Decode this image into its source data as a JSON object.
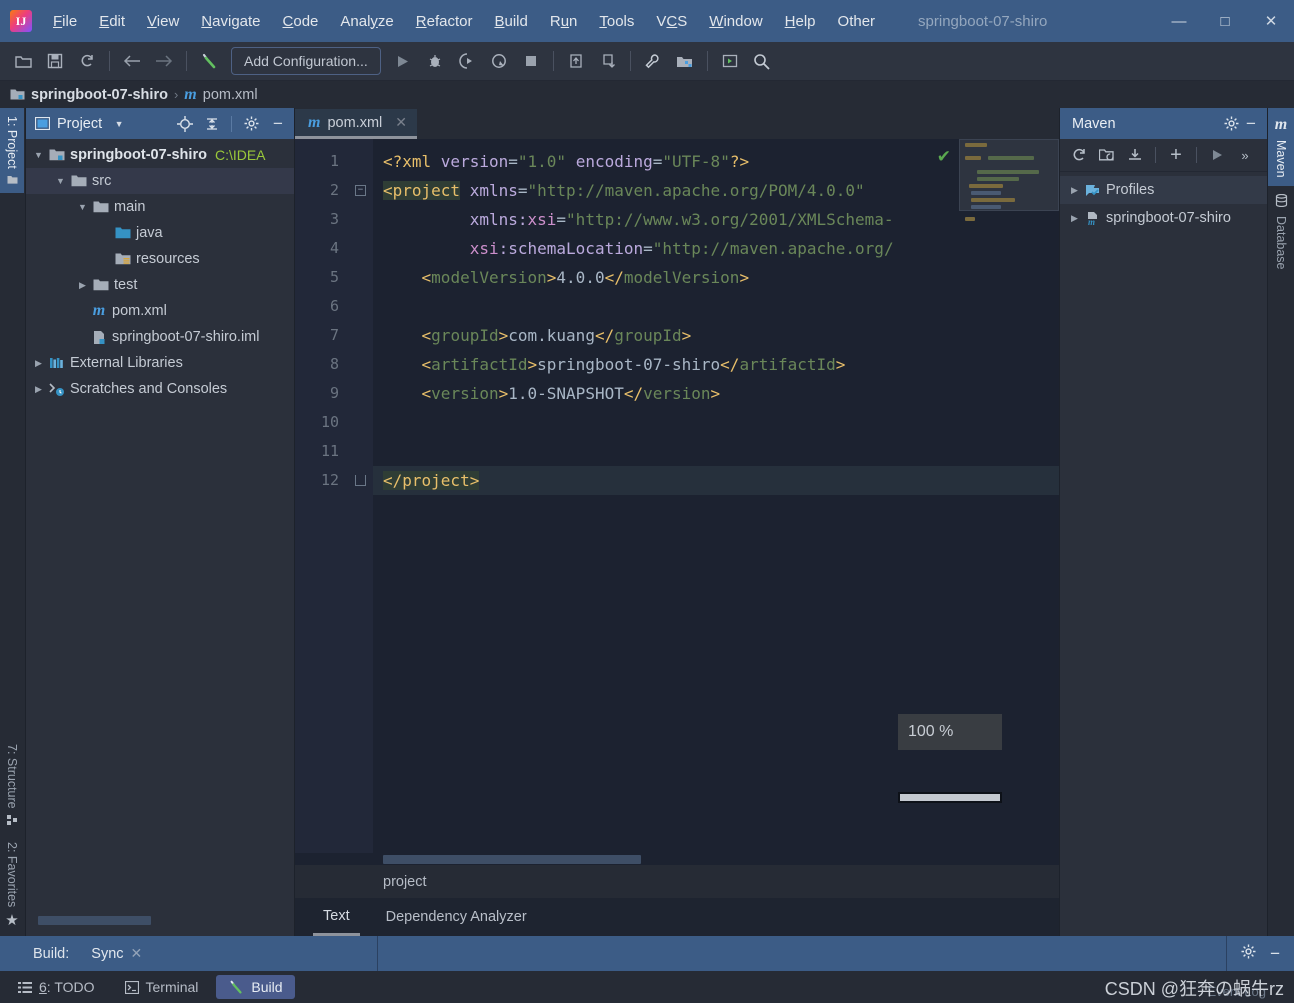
{
  "window": {
    "title": "springboot-07-shiro",
    "minimize": "—",
    "maximize": "□",
    "close": "✕"
  },
  "menu": [
    {
      "label": "File"
    },
    {
      "label": "Edit"
    },
    {
      "label": "View"
    },
    {
      "label": "Navigate"
    },
    {
      "label": "Code"
    },
    {
      "label": "Analyze"
    },
    {
      "label": "Refactor"
    },
    {
      "label": "Build"
    },
    {
      "label": "Run"
    },
    {
      "label": "Tools"
    },
    {
      "label": "VCS"
    },
    {
      "label": "Window"
    },
    {
      "label": "Help"
    },
    {
      "label": "Other"
    }
  ],
  "toolbar": {
    "run_config": "Add Configuration...",
    "icons": [
      "open-folder-icon",
      "save-icon",
      "sync-refresh-icon",
      "back-arrow-icon",
      "forward-arrow-icon",
      "build-hammer-icon",
      "run-icon",
      "debug-icon",
      "run-coverage-icon",
      "profile-icon",
      "stop-icon",
      "update-project-icon",
      "commit-icon",
      "settings-wrench-icon",
      "project-structure-icon",
      "run-anything-icon",
      "search-everywhere-icon"
    ]
  },
  "breadcrumb": {
    "project": "springboot-07-shiro",
    "separator": "›",
    "file": "pom.xml",
    "file_icon": "maven-m-icon"
  },
  "left_strip": {
    "top": [
      {
        "label": "1: Project",
        "icon": "project-folder-icon",
        "selected": true
      }
    ],
    "bottom": [
      {
        "label": "7: Structure",
        "icon": "structure-icon",
        "selected": false
      },
      {
        "label": "2: Favorites",
        "icon": "star-icon",
        "selected": false
      }
    ]
  },
  "right_strip": [
    {
      "label": "Maven",
      "icon": "maven-m-icon",
      "selected": true
    },
    {
      "label": "Database",
      "icon": "database-icon",
      "selected": false
    }
  ],
  "project_panel": {
    "title": "Project",
    "dropdown_icon": "chevron-down-icon",
    "actions": [
      "locate-target-icon",
      "collapse-all-icon",
      "gear-icon",
      "hide-icon"
    ],
    "tree": [
      {
        "depth": 0,
        "arrow": "▼",
        "icon": "module-folder-icon",
        "label": "springboot-07-shiro",
        "bold": true,
        "path": "C:\\IDEA",
        "selected": false
      },
      {
        "depth": 1,
        "arrow": "▼",
        "icon": "folder-icon",
        "label": "src",
        "bold": false,
        "path": "",
        "selected": true
      },
      {
        "depth": 2,
        "arrow": "▼",
        "icon": "folder-icon",
        "label": "main",
        "bold": false,
        "path": "",
        "selected": false
      },
      {
        "depth": 3,
        "arrow": "",
        "icon": "source-folder-icon",
        "label": "java",
        "bold": false,
        "path": "",
        "selected": false
      },
      {
        "depth": 3,
        "arrow": "",
        "icon": "resources-folder-icon",
        "label": "resources",
        "bold": false,
        "path": "",
        "selected": false
      },
      {
        "depth": 2,
        "arrow": "▶",
        "icon": "folder-icon",
        "label": "test",
        "bold": false,
        "path": "",
        "selected": false
      },
      {
        "depth": 2,
        "arrow": "",
        "icon": "maven-m-icon",
        "label": "pom.xml",
        "bold": false,
        "path": "",
        "selected": false
      },
      {
        "depth": 2,
        "arrow": "",
        "icon": "iml-file-icon",
        "label": "springboot-07-shiro.iml",
        "bold": false,
        "path": "",
        "selected": false
      },
      {
        "depth": 0,
        "arrow": "▶",
        "icon": "libraries-icon",
        "label": "External Libraries",
        "bold": false,
        "path": "",
        "selected": false
      },
      {
        "depth": 0,
        "arrow": "▶",
        "icon": "scratches-icon",
        "label": "Scratches and Consoles",
        "bold": false,
        "path": "",
        "selected": false
      }
    ]
  },
  "editor": {
    "tab": {
      "label": "pom.xml",
      "icon": "maven-m-icon",
      "close": "✕"
    },
    "inspection_status": "✔",
    "lines": [
      {
        "n": "1",
        "fold": "",
        "segments": [
          {
            "t": "<?xml ",
            "c": "k-pi"
          },
          {
            "t": "version",
            "c": "k-attr"
          },
          {
            "t": "=",
            "c": "k-txt"
          },
          {
            "t": "\"1.0\"",
            "c": "k-str"
          },
          {
            "t": " ",
            "c": "k-txt"
          },
          {
            "t": "encoding",
            "c": "k-attr"
          },
          {
            "t": "=",
            "c": "k-txt"
          },
          {
            "t": "\"UTF-8\"",
            "c": "k-str"
          },
          {
            "t": "?>",
            "c": "k-pi"
          }
        ]
      },
      {
        "n": "2",
        "fold": "−",
        "segments": [
          {
            "t": "<project",
            "c": "k-tag hl"
          },
          {
            "t": " ",
            "c": "k-txt"
          },
          {
            "t": "xmlns",
            "c": "k-attr"
          },
          {
            "t": "=",
            "c": "k-txt"
          },
          {
            "t": "\"http://maven.apache.org/POM/4.0.0\"",
            "c": "k-str"
          }
        ]
      },
      {
        "n": "3",
        "fold": "",
        "segments": [
          {
            "t": "         ",
            "c": "k-txt"
          },
          {
            "t": "xmlns:",
            "c": "k-attr"
          },
          {
            "t": "xsi",
            "c": "k-attr2"
          },
          {
            "t": "=",
            "c": "k-txt"
          },
          {
            "t": "\"http://www.w3.org/2001/XMLSchema-",
            "c": "k-str"
          }
        ]
      },
      {
        "n": "4",
        "fold": "",
        "segments": [
          {
            "t": "         ",
            "c": "k-txt"
          },
          {
            "t": "xsi",
            "c": "k-attr2"
          },
          {
            "t": ":schemaLocation",
            "c": "k-attr"
          },
          {
            "t": "=",
            "c": "k-txt"
          },
          {
            "t": "\"http://maven.apache.org/",
            "c": "k-str"
          }
        ]
      },
      {
        "n": "5",
        "fold": "",
        "segments": [
          {
            "t": "    ",
            "c": "k-txt"
          },
          {
            "t": "<modelVersion>",
            "c": "k-tag"
          },
          {
            "t": "4.0.0",
            "c": "k-txt"
          },
          {
            "t": "</modelVersion>",
            "c": "k-tag"
          }
        ]
      },
      {
        "n": "6",
        "fold": "",
        "segments": []
      },
      {
        "n": "7",
        "fold": "",
        "segments": [
          {
            "t": "    ",
            "c": "k-txt"
          },
          {
            "t": "<groupId>",
            "c": "k-tag"
          },
          {
            "t": "com.kuang",
            "c": "k-txt"
          },
          {
            "t": "</groupId>",
            "c": "k-tag"
          }
        ]
      },
      {
        "n": "8",
        "fold": "",
        "segments": [
          {
            "t": "    ",
            "c": "k-txt"
          },
          {
            "t": "<artifactId>",
            "c": "k-tag"
          },
          {
            "t": "springboot-07-shiro",
            "c": "k-txt"
          },
          {
            "t": "</artifactId>",
            "c": "k-tag"
          }
        ]
      },
      {
        "n": "9",
        "fold": "",
        "segments": [
          {
            "t": "    ",
            "c": "k-txt"
          },
          {
            "t": "<version>",
            "c": "k-tag"
          },
          {
            "t": "1.0-SNAPSHOT",
            "c": "k-txt"
          },
          {
            "t": "</version>",
            "c": "k-tag"
          }
        ]
      },
      {
        "n": "10",
        "fold": "",
        "segments": []
      },
      {
        "n": "11",
        "fold": "",
        "segments": []
      },
      {
        "n": "12",
        "fold": "⌂",
        "segments": [
          {
            "t": "</project>",
            "c": "k-tag hl"
          }
        ]
      }
    ],
    "progress": {
      "percent_label": "100 %",
      "percent_value": 100
    },
    "breadcrumb_bottom": "project",
    "view_tabs": [
      {
        "label": "Text",
        "selected": true
      },
      {
        "label": "Dependency Analyzer",
        "selected": false
      }
    ]
  },
  "maven_panel": {
    "title": "Maven",
    "actions": [
      "gear-icon",
      "hide-icon"
    ],
    "toolbar_icons": [
      "reload-all-icon",
      "generate-sources-icon",
      "download-sources-icon",
      "add-maven-project-icon",
      "run-maven-build-icon",
      "more-icon"
    ],
    "tree": [
      {
        "arrow": "▶",
        "icon": "profiles-flag-icon",
        "label": "Profiles",
        "selected": true
      },
      {
        "arrow": "▶",
        "icon": "maven-project-icon",
        "label": "springboot-07-shiro",
        "selected": false
      }
    ]
  },
  "build_bar": {
    "label": "Build:",
    "tab": "Sync",
    "close": "✕",
    "actions": [
      "gear-icon",
      "hide-icon"
    ]
  },
  "status_bar": {
    "items": [
      {
        "label": "6: TODO",
        "icon": "todo-list-icon",
        "selected": false
      },
      {
        "label": "Terminal",
        "icon": "terminal-icon",
        "selected": false
      },
      {
        "label": "Build",
        "icon": "build-hammer-icon",
        "selected": true
      }
    ],
    "event_log": "Event Log",
    "watermark": "CSDN @狂奔の蜗牛rz"
  },
  "colors": {
    "accent_blue": "#3c5c86",
    "panel_bg": "#2b303b",
    "editor_bg": "#1c2230",
    "string_green": "#6a8759",
    "tag_orange": "#e8bf6a",
    "path_green": "#9ac93a",
    "selection": "#34394a"
  }
}
